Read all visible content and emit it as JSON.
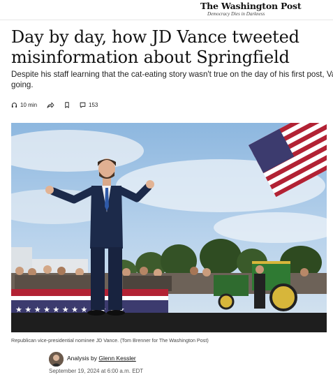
{
  "masthead": {
    "logo": "The Washington Post",
    "tagline": "Democracy Dies in Darkness"
  },
  "article": {
    "headline_line1": "Day by day, how JD Vance tweeted",
    "headline_line2": "misinformation about Springfield",
    "dek_line1": "Despite his staff learning that the cat-eating story wasn't true on the day of his first post, Vance doubled down and kept",
    "dek_line2": "going."
  },
  "toolbar": {
    "listen_label": "10 min",
    "comment_count": "153",
    "icons": [
      "headphones-icon",
      "share-icon",
      "bookmark-icon",
      "comment-icon"
    ]
  },
  "photo": {
    "caption": "Republican vice-presidential nominee JD Vance. (Tom Brenner for The Washington Post)"
  },
  "byline": {
    "prefix": "Analysis by",
    "author": "Glenn Kessler",
    "date": "September 19, 2024 at 6:00 a.m. EDT"
  },
  "colors": {
    "text": "#111111",
    "sky": "#9ec3e6",
    "suit": "#1c2a4a",
    "flag_red": "#b22234",
    "flag_blue": "#3c3b6e",
    "tractor_green": "#2f6b2f"
  }
}
